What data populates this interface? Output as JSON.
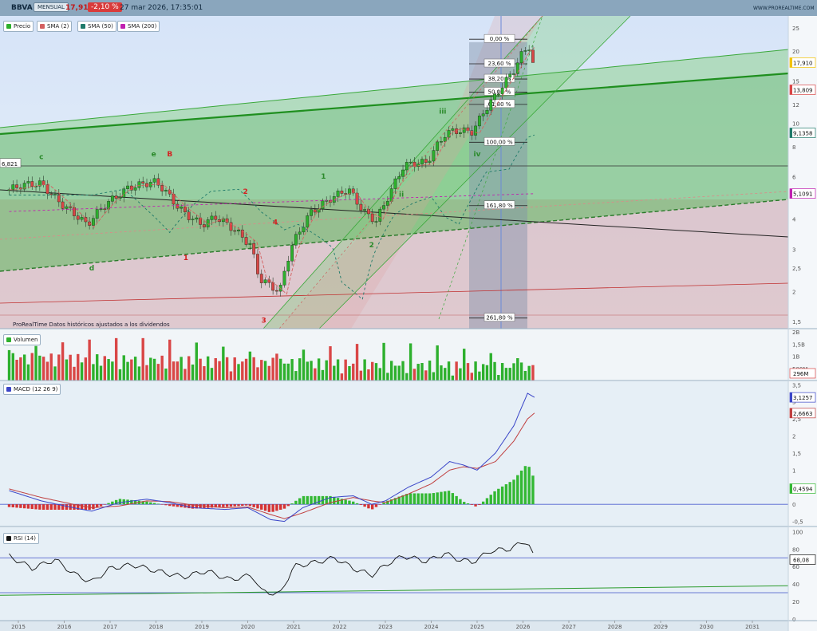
{
  "header": {
    "symbol": "BBVA",
    "period": "MENSUAL",
    "price": "17,910",
    "change": "-2,10 %",
    "datetime": "27 mar 2026, 17:35:01",
    "site": "WWW.PROREALTIME.COM"
  },
  "legends": {
    "price": "Precio",
    "sma1": "SMA (2)",
    "sma2": "SMA (50)",
    "sma3": "SMA (200)",
    "volume": "Volumen",
    "macd": "MACD (12 26 9)",
    "rsi": "RSI (14)"
  },
  "colors": {
    "up": "#2db02d",
    "down": "#d94646",
    "sma1": "#d46060",
    "sma2": "#1f7a6a",
    "sma3": "#c020b0",
    "macd": "#3a45c8",
    "signal": "#c04040",
    "histUp": "#33b833",
    "histDown": "#d63333",
    "green_band": "#37a637",
    "red_band": "#d08080"
  },
  "chart_data": {
    "type": "candlestick",
    "x_axis": {
      "ticks": [
        "2015",
        "2016",
        "2017",
        "2018",
        "2019",
        "2020",
        "2021",
        "2022",
        "2023",
        "2024",
        "2025",
        "2026",
        "2027",
        "2028",
        "2029",
        "2030",
        "2031"
      ],
      "start": 2015,
      "end": 2031.8
    },
    "price_panel": {
      "scale": "log",
      "ylim": [
        1.4,
        28
      ],
      "ticks": [
        1.5,
        2,
        2.5,
        3,
        4,
        5,
        6,
        8,
        10,
        12,
        15,
        20,
        25
      ],
      "tick_labels": [
        "1,5",
        "2",
        "2,5",
        "3",
        "4",
        "5",
        "6",
        "8",
        "10",
        "12",
        "15",
        "20",
        "25"
      ],
      "anchors": [
        [
          2014.8,
          5.3
        ],
        [
          2015.5,
          5.6
        ],
        [
          2016.0,
          4.6
        ],
        [
          2016.5,
          3.7
        ],
        [
          2017.0,
          4.8
        ],
        [
          2017.4,
          5.5
        ],
        [
          2018.0,
          5.6
        ],
        [
          2018.5,
          4.5
        ],
        [
          2019.0,
          3.8
        ],
        [
          2019.3,
          4.0
        ],
        [
          2019.8,
          3.5
        ],
        [
          2020.05,
          3.2
        ],
        [
          2020.25,
          2.3
        ],
        [
          2020.7,
          1.95
        ],
        [
          2020.95,
          3.0
        ],
        [
          2021.4,
          4.4
        ],
        [
          2021.8,
          4.9
        ],
        [
          2022.2,
          5.2
        ],
        [
          2022.5,
          4.3
        ],
        [
          2022.8,
          4.0
        ],
        [
          2023.1,
          5.2
        ],
        [
          2023.4,
          6.6
        ],
        [
          2023.9,
          6.8
        ],
        [
          2024.3,
          9.2
        ],
        [
          2024.5,
          9.5
        ],
        [
          2024.9,
          9.1
        ],
        [
          2025.0,
          9.8
        ],
        [
          2025.4,
          13.0
        ],
        [
          2025.8,
          17.0
        ],
        [
          2026.0,
          20.0
        ],
        [
          2026.15,
          21.0
        ],
        [
          2026.25,
          18.3
        ]
      ],
      "last_price": 17.91,
      "value_labels": [
        {
          "value": 17.91,
          "label": "17,910",
          "color": "#f2c200"
        },
        {
          "value": 13.809,
          "label": "13,809",
          "color": "#d94646"
        },
        {
          "value": 9.1358,
          "label": "9,1358",
          "color": "#1f7a6a"
        },
        {
          "value": 5.1091,
          "label": "5,1091",
          "color": "#c020b0"
        },
        {
          "value": 6.821,
          "label": "6,821",
          "color": "#444444"
        }
      ],
      "fibonacci": [
        {
          "value": 22.4,
          "label": "0,00 %"
        },
        {
          "value": 17.7,
          "label": "23,60 %"
        },
        {
          "value": 15.3,
          "label": "38,20 %"
        },
        {
          "value": 13.5,
          "label": "50,00 %"
        },
        {
          "value": 12.0,
          "label": "61,80 %"
        },
        {
          "value": 8.35,
          "label": "100,00 %"
        },
        {
          "value": 4.55,
          "label": "161,80 %"
        },
        {
          "value": 1.55,
          "label": "261,80 %"
        }
      ],
      "wave_labels": [
        {
          "t": 2015.5,
          "v": 7.1,
          "text": "c",
          "color": "#2a8a2a"
        },
        {
          "t": 2016.6,
          "v": 2.45,
          "text": "d",
          "color": "#2a8a2a"
        },
        {
          "t": 2017.95,
          "v": 7.3,
          "text": "e",
          "color": "#2a8a2a"
        },
        {
          "t": 2018.3,
          "v": 7.3,
          "text": "B",
          "color": "#d42020"
        },
        {
          "t": 2018.65,
          "v": 2.7,
          "text": "1",
          "color": "#d42020"
        },
        {
          "t": 2019.95,
          "v": 5.1,
          "text": "2",
          "color": "#d42020"
        },
        {
          "t": 2020.35,
          "v": 1.48,
          "text": "3",
          "color": "#d42020"
        },
        {
          "t": 2020.6,
          "v": 3.8,
          "text": "4",
          "color": "#d42020"
        },
        {
          "t": 2021.65,
          "v": 5.9,
          "text": "1",
          "color": "#2a8a2a"
        },
        {
          "t": 2022.7,
          "v": 3.05,
          "text": "2",
          "color": "#2a8a2a"
        },
        {
          "t": 2023.35,
          "v": 4.95,
          "text": "ii",
          "color": "#2a8a2a"
        },
        {
          "t": 2024.25,
          "v": 11.0,
          "text": "iii",
          "color": "#2a8a2a"
        },
        {
          "t": 2025.0,
          "v": 7.3,
          "text": "iv",
          "color": "#2a8a2a"
        }
      ],
      "disclaimer": "ProRealTime Datos históricos ajustados a los dividendos"
    },
    "volume_panel": {
      "ticks": [
        0.5,
        1,
        1.5,
        2
      ],
      "tick_labels": [
        "500M",
        "1B",
        "1,5B",
        "2B"
      ],
      "ylim": [
        0,
        2.1
      ],
      "last_label": "296M"
    },
    "macd_panel": {
      "ylim": [
        -0.65,
        3.6
      ],
      "ticks": [
        -0.5,
        0,
        0.5,
        1,
        1.5,
        2,
        2.5,
        3,
        3.5
      ],
      "tick_labels": [
        "-0,5",
        "0",
        "0,5",
        "1",
        "1,5",
        "2",
        "2,5",
        "3",
        "3,5"
      ],
      "macd_anchors": [
        [
          2014.8,
          0.4
        ],
        [
          2015.5,
          0.1
        ],
        [
          2016.2,
          -0.1
        ],
        [
          2016.6,
          -0.2
        ],
        [
          2017.2,
          0.05
        ],
        [
          2017.8,
          0.15
        ],
        [
          2018.3,
          0.05
        ],
        [
          2018.8,
          -0.1
        ],
        [
          2019.5,
          -0.15
        ],
        [
          2020.0,
          -0.1
        ],
        [
          2020.5,
          -0.45
        ],
        [
          2020.8,
          -0.5
        ],
        [
          2021.2,
          -0.1
        ],
        [
          2021.8,
          0.2
        ],
        [
          2022.3,
          0.25
        ],
        [
          2022.7,
          0.0
        ],
        [
          2023.0,
          0.1
        ],
        [
          2023.5,
          0.5
        ],
        [
          2024.0,
          0.8
        ],
        [
          2024.4,
          1.25
        ],
        [
          2024.7,
          1.15
        ],
        [
          2025.0,
          1.0
        ],
        [
          2025.4,
          1.5
        ],
        [
          2025.8,
          2.3
        ],
        [
          2026.1,
          3.25
        ],
        [
          2026.25,
          3.13
        ]
      ],
      "signal_anchors": [
        [
          2014.8,
          0.45
        ],
        [
          2015.5,
          0.2
        ],
        [
          2016.2,
          0.0
        ],
        [
          2016.6,
          -0.1
        ],
        [
          2017.2,
          -0.05
        ],
        [
          2017.8,
          0.1
        ],
        [
          2018.3,
          0.08
        ],
        [
          2018.8,
          -0.02
        ],
        [
          2019.5,
          -0.1
        ],
        [
          2020.0,
          -0.08
        ],
        [
          2020.5,
          -0.3
        ],
        [
          2020.8,
          -0.42
        ],
        [
          2021.2,
          -0.25
        ],
        [
          2021.8,
          0.05
        ],
        [
          2022.3,
          0.2
        ],
        [
          2022.7,
          0.1
        ],
        [
          2023.0,
          0.05
        ],
        [
          2023.5,
          0.3
        ],
        [
          2024.0,
          0.6
        ],
        [
          2024.4,
          1.0
        ],
        [
          2024.7,
          1.1
        ],
        [
          2025.0,
          1.05
        ],
        [
          2025.4,
          1.25
        ],
        [
          2025.8,
          1.85
        ],
        [
          2026.1,
          2.5
        ],
        [
          2026.25,
          2.67
        ]
      ],
      "macd_label": "3,1257",
      "signal_label": "2,6663",
      "hist_label": "0,4594"
    },
    "rsi_panel": {
      "ylim": [
        -2,
        105
      ],
      "ticks": [
        0,
        20,
        40,
        60,
        80,
        100
      ],
      "tick_labels": [
        "0",
        "20",
        "40",
        "60",
        "80",
        "100"
      ],
      "levels": [
        30,
        70
      ],
      "anchors": [
        [
          2014.8,
          72
        ],
        [
          2015.3,
          58
        ],
        [
          2015.8,
          68
        ],
        [
          2016.2,
          52
        ],
        [
          2016.6,
          42
        ],
        [
          2017.0,
          58
        ],
        [
          2017.5,
          62
        ],
        [
          2018.0,
          55
        ],
        [
          2018.6,
          48
        ],
        [
          2019.1,
          55
        ],
        [
          2019.6,
          45
        ],
        [
          2020.1,
          50
        ],
        [
          2020.3,
          32
        ],
        [
          2020.7,
          28
        ],
        [
          2021.0,
          60
        ],
        [
          2021.5,
          65
        ],
        [
          2021.9,
          70
        ],
        [
          2022.3,
          58
        ],
        [
          2022.7,
          50
        ],
        [
          2023.1,
          65
        ],
        [
          2023.4,
          72
        ],
        [
          2023.9,
          66
        ],
        [
          2024.3,
          75
        ],
        [
          2024.6,
          68
        ],
        [
          2024.9,
          65
        ],
        [
          2025.3,
          78
        ],
        [
          2025.7,
          80
        ],
        [
          2026.1,
          90
        ],
        [
          2026.25,
          68
        ]
      ],
      "last_label": "68,08"
    }
  }
}
